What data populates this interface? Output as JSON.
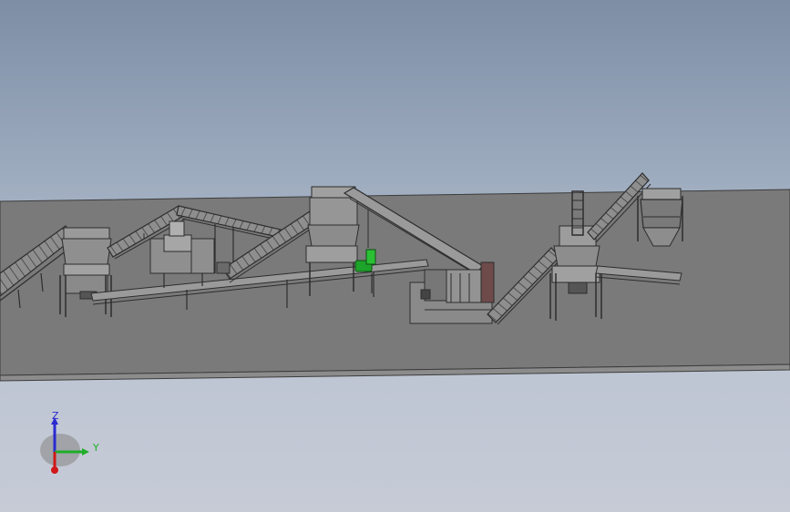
{
  "viewport": {
    "background_top": "#7d8ea5",
    "background_bottom": "#c6cbd6",
    "floor_color": "#7a7a7a"
  },
  "triad": {
    "z_label": "Z",
    "y_label": "Y",
    "z_color": "#2a2ad0",
    "y_color": "#1fae2a",
    "x_color": "#d01818"
  }
}
